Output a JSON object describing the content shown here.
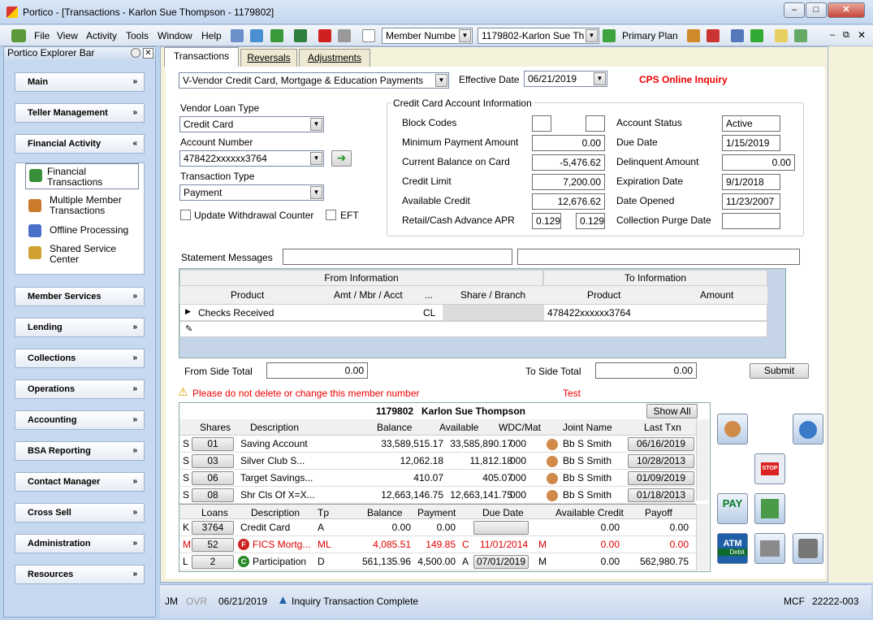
{
  "window": {
    "title": "Portico - [Transactions - Karlon Sue Thompson - 1179802]"
  },
  "menu": [
    "File",
    "View",
    "Activity",
    "Tools",
    "Window",
    "Help"
  ],
  "toolbar": {
    "search_type": "Member Numbe",
    "member": "1179802-Karlon Sue Th",
    "primary_plan": "Primary Plan"
  },
  "explorer": {
    "title": "Portico Explorer Bar",
    "sections": [
      "Main",
      "Teller Management",
      "Financial Activity",
      "Member Services",
      "Lending",
      "Collections",
      "Operations",
      "Accounting",
      "BSA Reporting",
      "Contact Manager",
      "Cross Sell",
      "Administration",
      "Resources"
    ],
    "financial_items": [
      "Financial Transactions",
      "Multiple Member Transactions",
      "Offline Processing",
      "Shared Service Center"
    ]
  },
  "tabs": [
    "Transactions",
    "Reversals",
    "Adjustments"
  ],
  "form": {
    "txn_category": "V-Vendor Credit Card, Mortgage & Education Payments",
    "effective_date_label": "Effective Date",
    "effective_date": "06/21/2019",
    "cps_link": "CPS Online Inquiry",
    "vendor_loan_type_label": "Vendor Loan Type",
    "vendor_loan_type": "Credit Card",
    "account_number_label": "Account Number",
    "account_number": "478422xxxxxx3764",
    "transaction_type_label": "Transaction Type",
    "transaction_type": "Payment",
    "update_withdrawal": "Update Withdrawal Counter",
    "eft": "EFT"
  },
  "cc": {
    "title": "Credit Card Account Information",
    "block_codes": "Block Codes",
    "min_payment_label": "Minimum Payment Amount",
    "min_payment": "0.00",
    "cur_bal_label": "Current Balance on Card",
    "cur_bal": "-5,476.62",
    "credit_limit_label": "Credit Limit",
    "credit_limit": "7,200.00",
    "avail_label": "Available Credit",
    "avail": "12,676.62",
    "apr_label": "Retail/Cash Advance APR",
    "apr1": "0.129",
    "apr2": "0.129",
    "status_label": "Account Status",
    "status": "Active",
    "due_label": "Due Date",
    "due": "1/15/2019",
    "delinq_label": "Delinquent Amount",
    "delinq": "0.00",
    "exp_label": "Expiration Date",
    "exp": "9/1/2018",
    "opened_label": "Date Opened",
    "opened": "11/23/2007",
    "purge_label": "Collection Purge Date"
  },
  "statement_label": "Statement Messages",
  "txn_grid": {
    "from": "From Information",
    "to": "To Information",
    "cols": [
      "Product",
      "Amt / Mbr / Acct",
      "...",
      "Share / Branch",
      "Product",
      "Amount"
    ],
    "row": [
      "Checks Received",
      "",
      "CL",
      "",
      "478422xxxxxx3764",
      ""
    ]
  },
  "totals": {
    "from_label": "From Side Total",
    "from": "0.00",
    "to_label": "To Side Total",
    "to": "0.00",
    "submit": "Submit"
  },
  "warning": "Please do not delete or change this member number",
  "warning_tag": "Test",
  "member": {
    "number": "1179802",
    "name": "Karlon Sue Thompson",
    "show_all": "Show All"
  },
  "shares": {
    "cols": [
      "Shares",
      "Description",
      "Balance",
      "Available",
      "WDC/Mat",
      "Joint Name",
      "Last Txn"
    ],
    "rows": [
      [
        "S",
        "01",
        "Saving Account",
        "33,589,515.17",
        "33,585,890.17",
        "000",
        "Bb S Smith",
        "06/16/2019"
      ],
      [
        "S",
        "03",
        "Silver Club    S...",
        "12,062.18",
        "11,812.18",
        "000",
        "Bb S Smith",
        "10/28/2013"
      ],
      [
        "S",
        "06",
        "Target Savings...",
        "410.07",
        "405.07",
        "000",
        "Bb S Smith",
        "01/09/2019"
      ],
      [
        "S",
        "08",
        "Shr Cls Of X=X...",
        "12,663,146.75",
        "12,663,141.75",
        "000",
        "Bb S Smith",
        "01/18/2013"
      ]
    ]
  },
  "loans": {
    "cols": [
      "Loans",
      "Description",
      "Tp",
      "Balance",
      "Payment",
      "Due Date",
      "Available Credit",
      "Payoff"
    ],
    "rows": [
      [
        "K",
        "3764",
        "",
        "Credit Card",
        "A",
        "0.00",
        "0.00",
        "",
        "",
        "",
        "0.00",
        "0.00"
      ],
      [
        "M",
        "52",
        "F",
        "FICS Mortg...",
        "ML",
        "4,085.51",
        "149.85",
        "C",
        "11/01/2014",
        "M",
        "0.00",
        "0.00"
      ],
      [
        "L",
        "2",
        "C",
        "Participation",
        "D",
        "561,135.96",
        "4,500.00",
        "A",
        "07/01/2019",
        "M",
        "0.00",
        "562,980.75"
      ]
    ]
  },
  "status": {
    "user": "JM",
    "ovr": "OVR",
    "date": "06/21/2019",
    "message": "Inquiry Transaction Complete",
    "code1": "MCF",
    "code2": "22222-003"
  },
  "icons": {
    "pay": "PAY",
    "atm": "ATM",
    "debit": "Debit",
    "stop": "STOP"
  }
}
